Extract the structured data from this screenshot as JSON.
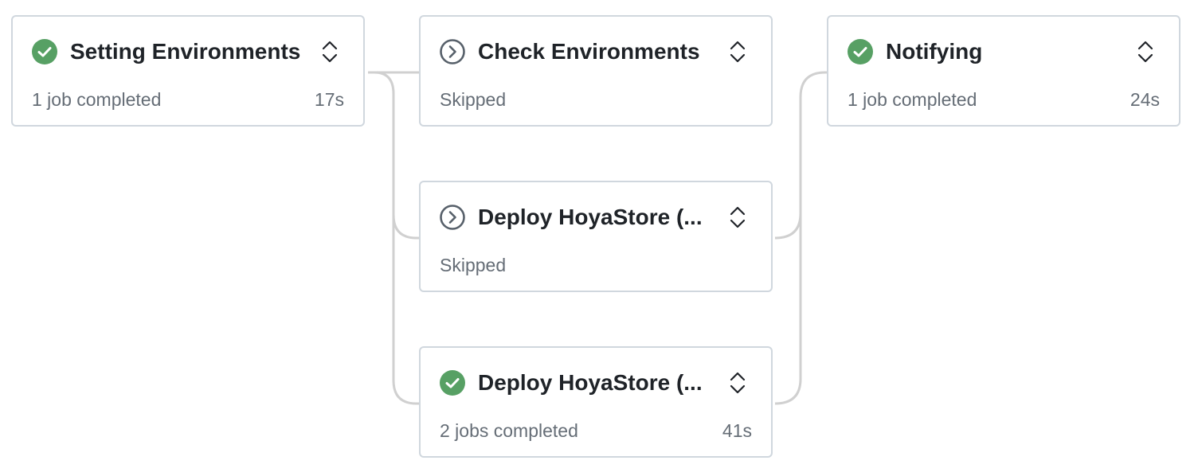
{
  "colors": {
    "success": "#57a064",
    "skipped": "#57606a",
    "connector": "#d0d0d0",
    "border": "#d0d7de"
  },
  "jobs": [
    {
      "title": "Setting Environments",
      "status_icon": "check-circle-icon",
      "status_text": "1 job completed",
      "duration": "17s"
    },
    {
      "title": "Check Environments",
      "status_icon": "skip-circle-icon",
      "status_text": "Skipped",
      "duration": ""
    },
    {
      "title": "Deploy HoyaStore (...",
      "status_icon": "skip-circle-icon",
      "status_text": "Skipped",
      "duration": ""
    },
    {
      "title": "Deploy HoyaStore (...",
      "status_icon": "check-circle-icon",
      "status_text": "2 jobs completed",
      "duration": "41s"
    },
    {
      "title": "Notifying",
      "status_icon": "check-circle-icon",
      "status_text": "1 job completed",
      "duration": "24s"
    }
  ]
}
